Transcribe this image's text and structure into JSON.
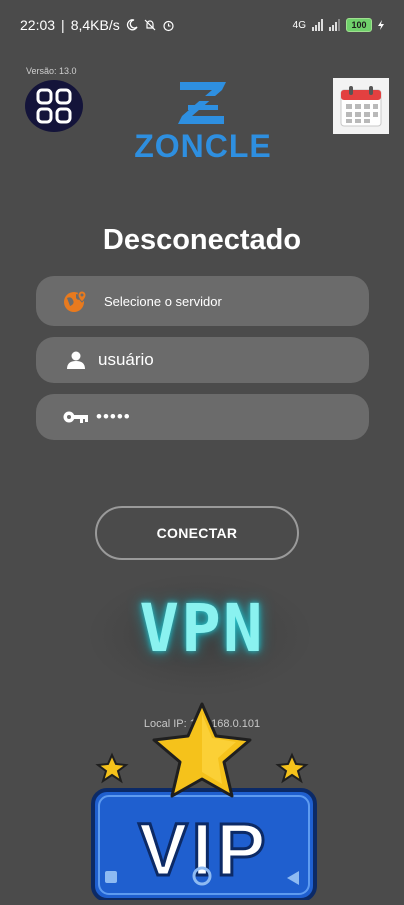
{
  "status_bar": {
    "time": "22:03",
    "speed": "8,4KB/s",
    "network": "4G",
    "battery": "100"
  },
  "app": {
    "version": "Versão: 13.0",
    "logo_text": "ZONCLE",
    "connection_status": "Desconectado"
  },
  "form": {
    "server_label": "Selecione o servidor",
    "username_value": "usuário",
    "password_value": "•••••"
  },
  "connect_button": "CONECTAR",
  "banner_text": "VPN",
  "local_ip": "Local IP: 192.168.0.101",
  "vip_text": "VIP",
  "colors": {
    "background": "#4b4b4b",
    "field": "#6b6b6b",
    "logo": "#2e8fe0",
    "vpn_glow": "#8af2f0",
    "vip_blue": "#1f5fcf",
    "star": "#f5c21b"
  },
  "icons": {
    "menu": "grid-icon",
    "calendar": "calendar-icon",
    "server": "globe-pin-icon",
    "user": "person-icon",
    "password": "key-icon"
  }
}
